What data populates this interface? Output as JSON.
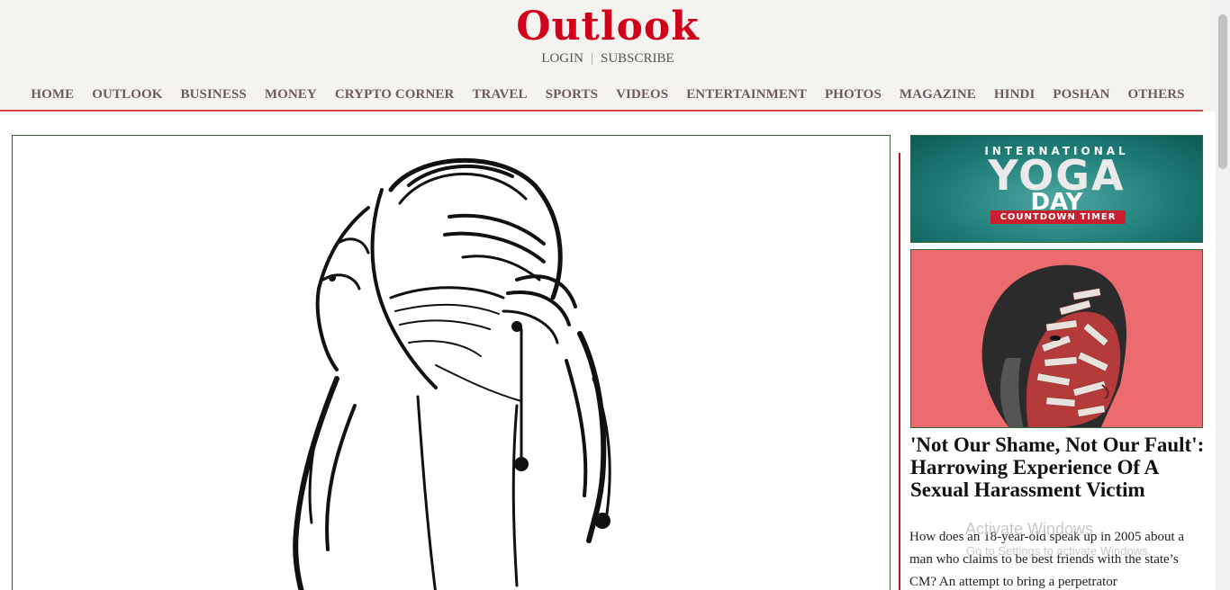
{
  "brand": {
    "logo": "Outlook"
  },
  "auth": {
    "login": "LOGIN",
    "subscribe": "SUBSCRIBE"
  },
  "nav": {
    "items": [
      "HOME",
      "OUTLOOK",
      "BUSINESS",
      "MONEY",
      "CRYPTO CORNER",
      "TRAVEL",
      "SPORTS",
      "VIDEOS",
      "ENTERTAINMENT",
      "PHOTOS",
      "MAGAZINE",
      "HINDI",
      "POSHAN",
      "OTHERS"
    ]
  },
  "ad": {
    "line1": "INTERNATIONAL",
    "line2": "YOGA",
    "line3": "DAY",
    "line4": "COUNTDOWN TIMER"
  },
  "story": {
    "title": "'Not Our Shame, Not Our Fault': Harrowing Experience Of A Sexual Harassment Victim",
    "description": "How does an 18-year-old speak up in 2005 about a man who claims to be best friends with the state’s CM? An attempt to bring a perpetrator"
  },
  "os_watermark": {
    "line1": "Activate Windows",
    "line2": "Go to Settings to activate Windows."
  },
  "colors": {
    "brand_red": "#d0021b",
    "nav_text": "#6b5a5f",
    "rule_red": "#d24545",
    "frame_green": "#2f6b2f"
  }
}
